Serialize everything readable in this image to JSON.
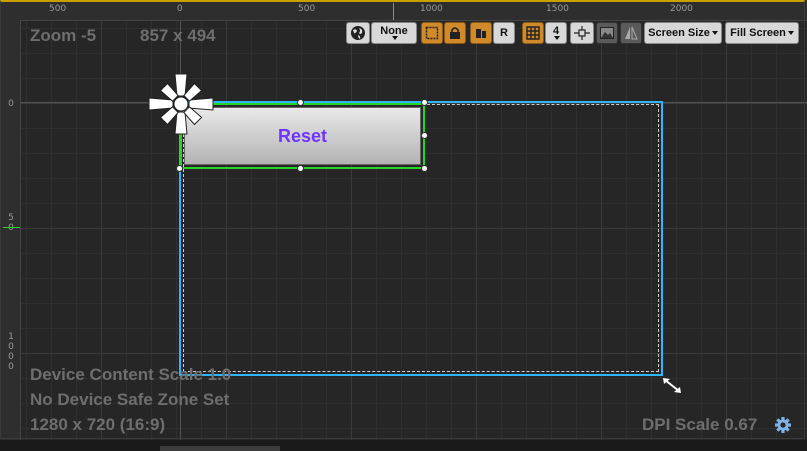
{
  "rulers": {
    "top": [
      "500",
      "0",
      "500",
      "1000",
      "1500",
      "2000"
    ],
    "left": [
      "0",
      "5\n0",
      "1\n0\n0\n0"
    ]
  },
  "viewport": {
    "zoom_label": "Zoom -5",
    "size_label": "857 x 494",
    "content_scale": "Device Content Scale 1.0",
    "safe_zone": "No Device Safe Zone Set",
    "resolution": "1280 x 720 (16:9)",
    "dpi_scale": "DPI Scale 0.67"
  },
  "toolbar": {
    "globe_icon": "globe-icon",
    "culture_label": "None",
    "grid_snap_value": "4",
    "r_label": "R",
    "screen_size_label": "Screen Size",
    "fill_screen_label": "Fill Screen"
  },
  "widget": {
    "reset_label": "Reset"
  },
  "colors": {
    "selection": "#27d527",
    "design_frame": "#2fb4ff",
    "reset_text": "#6f34ff",
    "active_toggle": "#d08a2a"
  }
}
